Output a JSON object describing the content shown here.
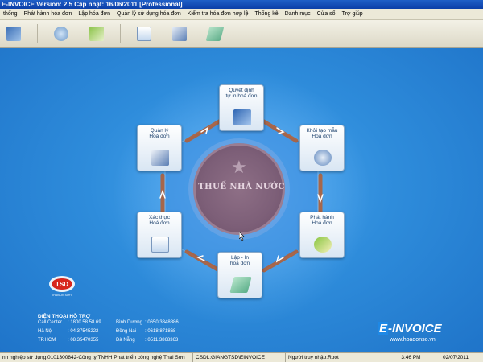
{
  "window": {
    "title": "E-INVOICE Version: 2.5 Cập nhật: 16/06/2011 [Professional]"
  },
  "menu": {
    "items": [
      "thống",
      "Phát hành hóa đơn",
      "Lập hóa đơn",
      "Quản lý sử dụng hóa đơn",
      "Kiểm tra hóa đơn hợp lệ",
      "Thống kê",
      "Danh mục",
      "Cửa sổ",
      "Trợ giúp"
    ]
  },
  "toolbar": {
    "buttons": [
      {
        "icon": "book-exit-icon"
      },
      {
        "icon": "system-settings-icon"
      },
      {
        "icon": "create-invoice-icon"
      },
      {
        "icon": "id-card-icon"
      },
      {
        "icon": "document-print-icon"
      },
      {
        "icon": "invoice-stack-icon"
      }
    ]
  },
  "workflow": {
    "nodes": [
      {
        "label": "Quyết định\ntự in hoá đơn"
      },
      {
        "label": "Khởi tạo mẫu\nHoá đơn"
      },
      {
        "label": "Phát hành\nHoá đơn"
      },
      {
        "label": "Lập - In\nhoá đơn"
      },
      {
        "label": "Xác thực\nHoá đơn"
      },
      {
        "label": "Quản lý\nHoá đơn"
      }
    ],
    "emblem_text": "THUẾ NHÀ NƯỚC"
  },
  "support": {
    "title": "ĐIỆN THOẠI HỖ TRỢ",
    "contacts": [
      {
        "name": "Call Center",
        "phone": ": 1800 58 58 69"
      },
      {
        "name": "Hà Nội",
        "phone": ": 04.37545222"
      },
      {
        "name": "TP.HCM",
        "phone": ": 08.35470355"
      },
      {
        "name": "Bình Dương",
        "phone": ": 0650.3848886"
      },
      {
        "name": "Đồng Nai",
        "phone": ": 0618.871868"
      },
      {
        "name": "Đà Nẵng",
        "phone": ": 0511.3868363"
      }
    ],
    "logo_text": "TSD",
    "logo_subtext": "THAISON SOFT"
  },
  "brand": {
    "name": "-INVOICE",
    "prefix": "E",
    "url": "www.hoadonso.vn"
  },
  "status": {
    "company": "nh nghiệp sử dụng:0101300842-Công ty TNHH Phát triển công nghệ Thái Sơn",
    "db": "CSDL:GIANGTSD\\EINVOICE",
    "user": "Người truy nhập:Root",
    "time": "3:46 PM",
    "date": "02/07/2011"
  },
  "colors": {
    "background": "#2f8bd8",
    "arrow": "#a0522d",
    "emblem": "#7d5f78"
  }
}
